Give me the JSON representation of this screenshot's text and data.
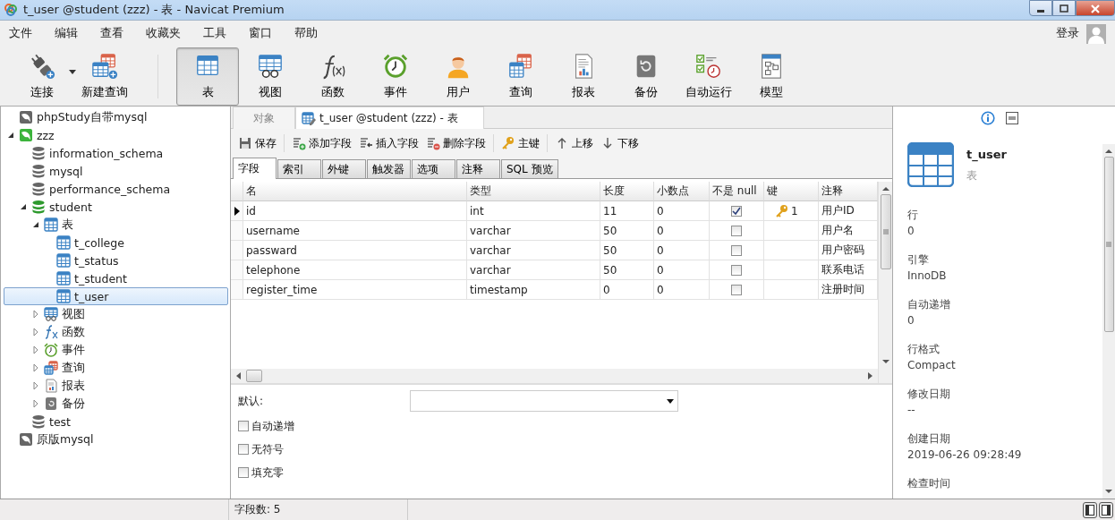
{
  "window": {
    "title": "t_user @student (zzz) - 表 - Navicat Premium"
  },
  "menu": [
    "文件",
    "编辑",
    "查看",
    "收藏夹",
    "工具",
    "窗口",
    "帮助"
  ],
  "login": "登录",
  "toolbar": [
    {
      "label": "连接",
      "kind": "connect",
      "dropdown": true,
      "selected": false
    },
    {
      "label": "新建查询",
      "kind": "new-query",
      "dropdown": false,
      "selected": false
    },
    {
      "label": "表",
      "kind": "table",
      "dropdown": false,
      "selected": true
    },
    {
      "label": "视图",
      "kind": "view",
      "dropdown": false,
      "selected": false
    },
    {
      "label": "函数",
      "kind": "function",
      "dropdown": false,
      "selected": false
    },
    {
      "label": "事件",
      "kind": "event",
      "dropdown": false,
      "selected": false
    },
    {
      "label": "用户",
      "kind": "user",
      "dropdown": false,
      "selected": false
    },
    {
      "label": "查询",
      "kind": "query",
      "dropdown": false,
      "selected": false
    },
    {
      "label": "报表",
      "kind": "report",
      "dropdown": false,
      "selected": false
    },
    {
      "label": "备份",
      "kind": "backup",
      "dropdown": false,
      "selected": false
    },
    {
      "label": "自动运行",
      "kind": "autorun",
      "dropdown": false,
      "selected": false
    },
    {
      "label": "模型",
      "kind": "model",
      "dropdown": false,
      "selected": false
    }
  ],
  "tree": [
    {
      "label": "phpStudy自带mysql",
      "kind": "connection",
      "open": false,
      "selected": false
    },
    {
      "label": "zzz",
      "kind": "connection",
      "open": true,
      "selected": false,
      "expanded": true,
      "children": [
        {
          "label": "information_schema",
          "kind": "database",
          "open": false,
          "selected": false
        },
        {
          "label": "mysql",
          "kind": "database",
          "open": false,
          "selected": false
        },
        {
          "label": "performance_schema",
          "kind": "database",
          "open": false,
          "selected": false
        },
        {
          "label": "student",
          "kind": "database",
          "open": true,
          "selected": false,
          "expanded": true,
          "children": [
            {
              "label": "表",
              "kind": "table",
              "selected": false,
              "expanded": true,
              "children": [
                {
                  "label": "t_college",
                  "kind": "table",
                  "selected": false
                },
                {
                  "label": "t_status",
                  "kind": "table",
                  "selected": false
                },
                {
                  "label": "t_student",
                  "kind": "table",
                  "selected": false
                },
                {
                  "label": "t_user",
                  "kind": "table",
                  "selected": true
                }
              ]
            },
            {
              "label": "视图",
              "kind": "view",
              "selected": false,
              "expanded": false
            },
            {
              "label": "函数",
              "kind": "function",
              "selected": false,
              "expanded": false
            },
            {
              "label": "事件",
              "kind": "event",
              "selected": false,
              "expanded": false
            },
            {
              "label": "查询",
              "kind": "query",
              "selected": false,
              "expanded": false
            },
            {
              "label": "报表",
              "kind": "report",
              "selected": false,
              "expanded": false
            },
            {
              "label": "备份",
              "kind": "backup",
              "selected": false,
              "expanded": false
            }
          ]
        },
        {
          "label": "test",
          "kind": "database",
          "open": false,
          "selected": false
        }
      ]
    },
    {
      "label": "原版mysql",
      "kind": "connection",
      "open": false,
      "selected": false
    }
  ],
  "tabs": [
    {
      "label": "对象",
      "kind": "object",
      "selected": false
    },
    {
      "label": "t_user @student (zzz) - 表",
      "kind": "design",
      "selected": true
    }
  ],
  "actions": [
    {
      "label": "保存",
      "kind": "save"
    },
    {
      "label": "添加字段",
      "kind": "add"
    },
    {
      "label": "插入字段",
      "kind": "insert"
    },
    {
      "label": "删除字段",
      "kind": "delete"
    },
    {
      "label": "主键",
      "kind": "key"
    },
    {
      "label": "上移",
      "kind": "up"
    },
    {
      "label": "下移",
      "kind": "down"
    }
  ],
  "subtabs": [
    {
      "label": "字段",
      "selected": true
    },
    {
      "label": "索引",
      "selected": false
    },
    {
      "label": "外键",
      "selected": false
    },
    {
      "label": "触发器",
      "selected": false
    },
    {
      "label": "选项",
      "selected": false
    },
    {
      "label": "注释",
      "selected": false
    },
    {
      "label": "SQL 预览",
      "selected": false
    }
  ],
  "table": {
    "columns": [
      "名",
      "类型",
      "长度",
      "小数点",
      "不是 null",
      "键",
      "注释"
    ],
    "rows": [
      {
        "name": "id",
        "type": "int",
        "length": "11",
        "decimals": "0",
        "not_null": true,
        "key": "1",
        "comment": "用户ID",
        "current": true
      },
      {
        "name": "username",
        "type": "varchar",
        "length": "50",
        "decimals": "0",
        "not_null": false,
        "comment": "用户名",
        "current": false
      },
      {
        "name": "passward",
        "type": "varchar",
        "length": "50",
        "decimals": "0",
        "not_null": false,
        "comment": "用户密码",
        "current": false
      },
      {
        "name": "telephone",
        "type": "varchar",
        "length": "50",
        "decimals": "0",
        "not_null": false,
        "comment": "联系电话",
        "current": false
      },
      {
        "name": "register_time",
        "type": "timestamp",
        "length": "0",
        "decimals": "0",
        "not_null": false,
        "comment": "注册时间",
        "current": false
      }
    ]
  },
  "default": {
    "label": "默认:"
  },
  "options": [
    {
      "label": "自动递增",
      "checked": false
    },
    {
      "label": "无符号",
      "checked": false
    },
    {
      "label": "填充零",
      "checked": false
    }
  ],
  "status": "字段数: 5",
  "info": {
    "name": "t_user",
    "type": "表",
    "properties": [
      {
        "label": "行",
        "value": "0"
      },
      {
        "label": "引擎",
        "value": "InnoDB"
      },
      {
        "label": "自动递增",
        "value": "0"
      },
      {
        "label": "行格式",
        "value": "Compact"
      },
      {
        "label": "修改日期",
        "value": "--"
      },
      {
        "label": "创建日期",
        "value": "2019-06-26 09:28:49"
      },
      {
        "label": "检查时间"
      }
    ]
  }
}
